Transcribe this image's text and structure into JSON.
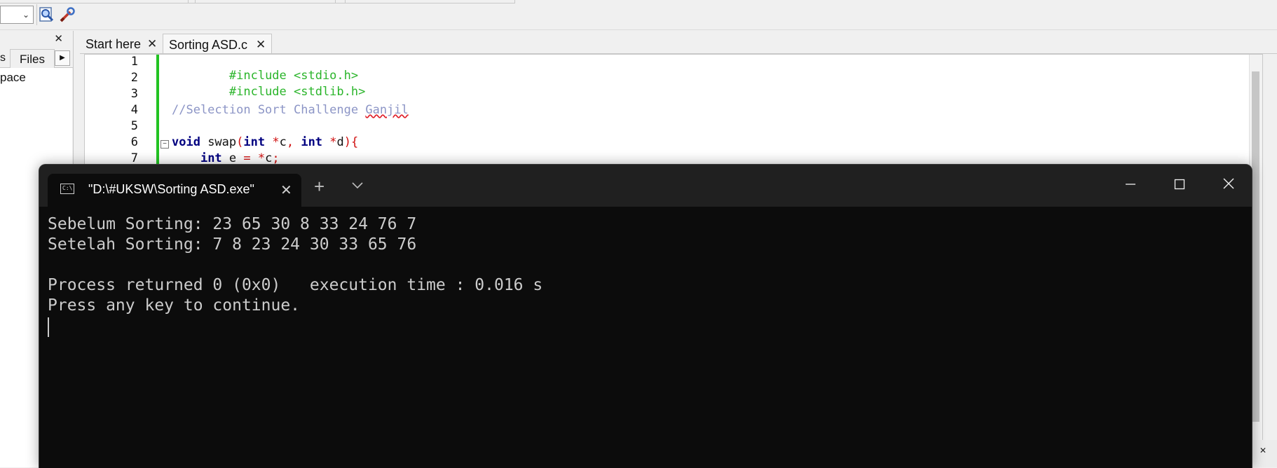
{
  "editor": {
    "tabs": [
      {
        "label": "Start here"
      },
      {
        "label": "Sorting ASD.c"
      }
    ],
    "line_numbers": [
      "1",
      "2",
      "3",
      "4",
      "5",
      "6",
      "7"
    ],
    "code": {
      "line1": "#include <stdio.h>",
      "line2": "#include <stdlib.h>",
      "line4_comment": "//Selection Sort Challenge ",
      "line4_squiggle": "Ganjil",
      "line6_void": "void",
      "line6_swap": " swap",
      "line6_paren": "(",
      "line6_int1": "int",
      "line6_star1": " *",
      "line6_c": "c",
      "line6_comma": ", ",
      "line6_int2": "int",
      "line6_star2": " *",
      "line6_d": "d",
      "line6_close": "){",
      "line7_indent": "    ",
      "line7_int": "int",
      "line7_e": " e ",
      "line7_eq": "= *",
      "line7_c": "c",
      "line7_semi": ";"
    }
  },
  "management": {
    "tab_prev": "s",
    "tab_files": "Files",
    "tree_item": "pace"
  },
  "terminal": {
    "tab_title": "\"D:\\#UKSW\\Sorting ASD.exe\"",
    "icon_text": "C:\\",
    "output": [
      "Sebelum Sorting: 23 65 30 8 33 24 76 7",
      "Setelah Sorting: 7 8 23 24 30 33 65 76",
      "",
      "Process returned 0 (0x0)   execution time : 0.016 s",
      "Press any key to continue."
    ]
  },
  "colors": {
    "terminal_bg": "#0c0c0c",
    "terminal_titlebar": "#202020",
    "terminal_text": "#cccccc",
    "preprocessor_green": "#2bb52b",
    "comment_blue": "#8c95c6",
    "keyword_navy": "#000080",
    "operator_red": "#d01010"
  }
}
